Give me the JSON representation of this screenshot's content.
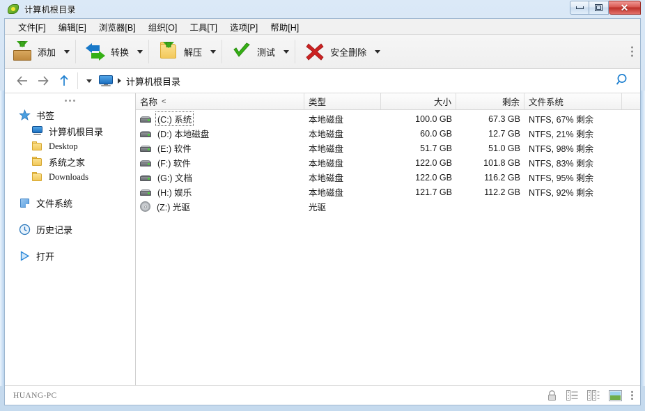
{
  "window": {
    "title": "计算机根目录",
    "icon": "peazip-icon",
    "controls": {
      "minimize": "最小化",
      "maximize": "最大化",
      "close": "✕"
    }
  },
  "menubar": {
    "items": [
      {
        "label": "文件[F]",
        "name": "menu-file"
      },
      {
        "label": "编辑[E]",
        "name": "menu-edit"
      },
      {
        "label": "浏览器[B]",
        "name": "menu-browser"
      },
      {
        "label": "组织[O]",
        "name": "menu-organize"
      },
      {
        "label": "工具[T]",
        "name": "menu-tools"
      },
      {
        "label": "选项[P]",
        "name": "menu-options"
      },
      {
        "label": "帮助[H]",
        "name": "menu-help"
      }
    ]
  },
  "toolbar": {
    "buttons": [
      {
        "label": "添加",
        "icon": "box-add-icon"
      },
      {
        "label": "转换",
        "icon": "convert-arrows-icon"
      },
      {
        "label": "解压",
        "icon": "folder-extract-icon"
      },
      {
        "label": "测试",
        "icon": "green-check-icon"
      },
      {
        "label": "安全删除",
        "icon": "red-x-icon"
      }
    ],
    "overflow_icon": "toolbar-overflow-icon"
  },
  "addressbar": {
    "back_icon": "back-arrow-icon",
    "forward_icon": "forward-arrow-icon",
    "up_icon": "up-arrow-icon",
    "history_caret_icon": "chevron-down-icon",
    "location_icon": "monitor-icon",
    "crumb_separator_icon": "chevron-right-icon",
    "path": "计算机根目录",
    "search_icon": "search-icon"
  },
  "sidebar": {
    "overflow_icon": "sidebar-overflow-icon",
    "sections": [
      {
        "label": "书签",
        "icon": "star-icon",
        "children": [
          {
            "label": "计算机根目录",
            "icon": "monitor-icon"
          },
          {
            "label": "Desktop",
            "icon": "folder-icon"
          },
          {
            "label": "系统之家",
            "icon": "folder-icon"
          },
          {
            "label": "Downloads",
            "icon": "folder-icon"
          }
        ]
      },
      {
        "label": "文件系统",
        "icon": "filesystem-icon",
        "children": []
      },
      {
        "label": "历史记录",
        "icon": "clock-icon",
        "children": []
      },
      {
        "label": "打开",
        "icon": "play-triangle-icon",
        "children": []
      }
    ]
  },
  "filelist": {
    "columns": [
      {
        "label": "名称",
        "align": "left",
        "sorted": true,
        "sort_indicator": "<"
      },
      {
        "label": "类型",
        "align": "left"
      },
      {
        "label": "大小",
        "align": "right"
      },
      {
        "label": "剩余",
        "align": "right"
      },
      {
        "label": "文件系统",
        "align": "left"
      }
    ],
    "rows": [
      {
        "icon": "hard-drive-icon",
        "name": "(C:) 系统",
        "type": "本地磁盘",
        "size": "100.0 GB",
        "free": "67.3 GB",
        "fs": "NTFS, 67% 剩余",
        "focused": true
      },
      {
        "icon": "hard-drive-icon",
        "name": "(D:) 本地磁盘",
        "type": "本地磁盘",
        "size": "60.0 GB",
        "free": "12.7 GB",
        "fs": "NTFS, 21% 剩余",
        "focused": false
      },
      {
        "icon": "hard-drive-icon",
        "name": "(E:) 软件",
        "type": "本地磁盘",
        "size": "51.7 GB",
        "free": "51.0 GB",
        "fs": "NTFS, 98% 剩余",
        "focused": false
      },
      {
        "icon": "hard-drive-icon",
        "name": "(F:) 软件",
        "type": "本地磁盘",
        "size": "122.0 GB",
        "free": "101.8 GB",
        "fs": "NTFS, 83% 剩余",
        "focused": false
      },
      {
        "icon": "hard-drive-icon",
        "name": "(G:) 文档",
        "type": "本地磁盘",
        "size": "122.0 GB",
        "free": "116.2 GB",
        "fs": "NTFS, 95% 剩余",
        "focused": false
      },
      {
        "icon": "hard-drive-icon",
        "name": "(H:) 娱乐",
        "type": "本地磁盘",
        "size": "121.7 GB",
        "free": "112.2 GB",
        "fs": "NTFS, 92% 剩余",
        "focused": false
      },
      {
        "icon": "optical-drive-icon",
        "name": "(Z:) 光驱",
        "type": "光驱",
        "size": "",
        "free": "",
        "fs": "",
        "focused": false
      }
    ]
  },
  "statusbar": {
    "text": "HUANG-PC",
    "icons": [
      {
        "name": "lock-icon"
      },
      {
        "name": "list-view-icon"
      },
      {
        "name": "detail-view-icon"
      },
      {
        "name": "thumbnail-view-icon",
        "active": true
      },
      {
        "name": "status-overflow-icon"
      }
    ]
  },
  "colors": {
    "accent": "#1d6fc0",
    "frame": "#c5daee",
    "close_button": "#bc2f28",
    "green": "#35b015",
    "red": "#cc2222"
  }
}
